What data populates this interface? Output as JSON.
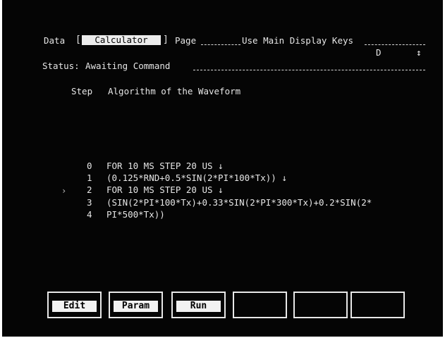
{
  "header": {
    "data_label": "Data",
    "data_field": "Calculator",
    "page_label": "Page",
    "hint": "Use Main Display Keys",
    "indicator_d": "D",
    "indicator_arrow": "↕"
  },
  "status": {
    "label": "Status:",
    "text": "Awaiting Command"
  },
  "algorithm": {
    "step_header": "Step",
    "title_header": "Algorithm of the Waveform",
    "current_marker": "›",
    "lines": [
      {
        "step": "0",
        "code": "FOR 10 MS STEP 20 US ↓"
      },
      {
        "step": "1",
        "code": "(0.125*RND+0.5*SIN(2*PI*100*Tx)) ↓"
      },
      {
        "step": "2",
        "code": "FOR 10 MS STEP 20 US ↓"
      },
      {
        "step": "3",
        "code": "(SIN(2*PI*100*Tx)+0.33*SIN(2*PI*300*Tx)+0.2*SIN(2*"
      },
      {
        "step": "4",
        "code": "PI*500*Tx))"
      }
    ]
  },
  "softkeys": [
    {
      "label": "Edit"
    },
    {
      "label": "Param"
    },
    {
      "label": "Run"
    },
    {
      "label": ""
    },
    {
      "label": ""
    },
    {
      "label": ""
    }
  ],
  "colors": {
    "screen_background": "#050505",
    "foreground": "#e6e6e6"
  }
}
